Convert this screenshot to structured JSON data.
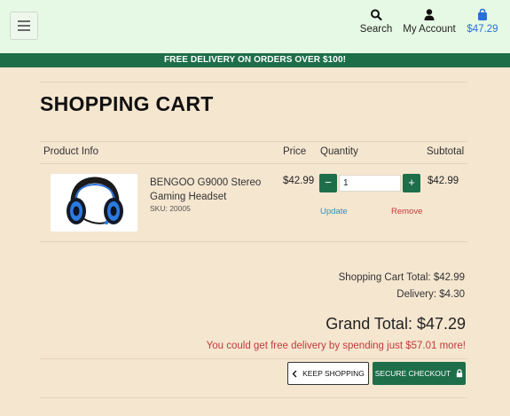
{
  "header": {
    "nav": {
      "search_label": "Search",
      "account_label": "My Account",
      "cart_total": "$47.29"
    },
    "icons": {
      "menu": "hamburger-icon",
      "search": "search-icon",
      "account": "user-icon",
      "cart": "shopping-bag-icon"
    }
  },
  "banner": {
    "text": "FREE DELIVERY ON ORDERS OVER $100!"
  },
  "page": {
    "title": "SHOPPING CART"
  },
  "table": {
    "headers": {
      "product_info": "Product Info",
      "price": "Price",
      "quantity": "Quantity",
      "subtotal": "Subtotal"
    },
    "rows": [
      {
        "name": "BENGOO G9000 Stereo Gaming Headset",
        "sku": "SKU: 20005",
        "price": "$42.99",
        "quantity": "1",
        "subtotal": "$42.99",
        "update_label": "Update",
        "remove_label": "Remove",
        "minus_label": "−",
        "plus_label": "+"
      }
    ]
  },
  "summary": {
    "cart_total": "Shopping Cart Total: $42.99",
    "delivery": "Delivery: $4.30",
    "grand_total": "Grand Total: $47.29",
    "free_delivery_msg": "You could get free delivery by spending just $57.01 more!"
  },
  "actions": {
    "keep_shopping": "KEEP SHOPPING",
    "secure_checkout": "SECURE CHECKOUT"
  },
  "colors": {
    "header_bg": "#e6f9e4",
    "banner_bg": "#1e6e4a",
    "page_bg": "#f5e6d0",
    "accent_blue": "#2b6fd8",
    "alert_red": "#c23a3a",
    "link_blue": "#2d8fbf"
  }
}
